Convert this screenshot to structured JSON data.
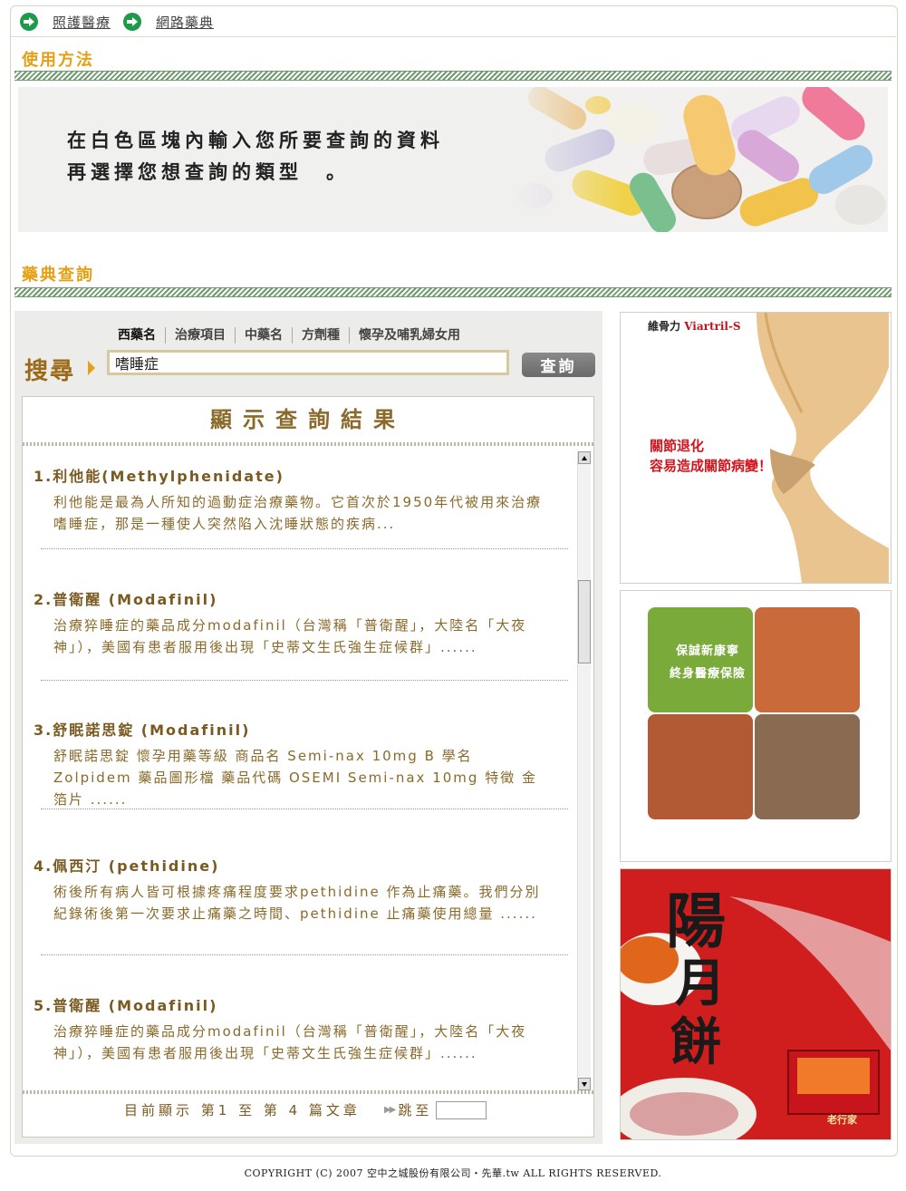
{
  "breadcrumb": {
    "items": [
      "照護醫療",
      "網路藥典"
    ]
  },
  "usage": {
    "title": "使用方法",
    "line1": "在白色區塊內輸入您所要查詢的資料",
    "line2": "再選擇您想查詢的類型　。"
  },
  "lookup": {
    "title": "藥典查詢",
    "tabs": [
      "西藥名",
      "治療項目",
      "中藥名",
      "方劑種",
      "懷孕及哺乳婦女用"
    ],
    "search_label": "搜尋",
    "search_value": "嗜睡症",
    "search_button": "查詢",
    "results_title": "顯示查詢結果",
    "results": [
      {
        "title": "1.利他能(Methylphenidate)",
        "desc": "利他能是最為人所知的過動症治療藥物。它首次於1950年代被用來治療嗜睡症，那是一種使人突然陷入沈睡狀態的疾病..."
      },
      {
        "title": "2.普衛醒 (Modafinil)",
        "desc": "治療猝睡症的藥品成分modafinil（台灣稱「普衛醒」，大陸名「大夜神」），美國有患者服用後出現「史蒂文生氏強生症候群」......"
      },
      {
        "title": "3.舒眠諾思錠 (Modafinil)",
        "desc": "舒眠諾思錠 懷孕用藥等級 商品名 Semi-nax 10mg B 學名 Zolpidem 藥品圖形檔 藥品代碼 OSEMI Semi-nax 10mg 特徵 金箔片 ......"
      },
      {
        "title": "4.佩西汀 (pethidine)",
        "desc": "術後所有病人皆可根據疼痛程度要求pethidine 作為止痛藥。我們分別紀錄術後第一次要求止痛藥之時間、pethidine 止痛藥使用總量 ......"
      },
      {
        "title": "5.普衛醒 (Modafinil)",
        "desc": "治療猝睡症的藥品成分modafinil（台灣稱「普衛醒」，大陸名「大夜神」），美國有患者服用後出現「史蒂文生氏強生症候群」......"
      }
    ],
    "pager": {
      "current": "目前顯示 第1 至 第 4 篇文章",
      "jump_label": "跳至",
      "jump_value": ""
    }
  },
  "ads": {
    "ad1_brand": "維骨力",
    "ad1_brand_en": "Viartril-S",
    "ad1_line1": "關節退化",
    "ad1_line2": "容易造成關節病變！",
    "ad2_line1": "保誠新康寧",
    "ad2_line2": "終身醫療保險",
    "ad3_title": "陽月餅",
    "ad3_brand": "老行家"
  },
  "footer": {
    "text": "COPYRIGHT (C) 2007 空中之城股份有限公司・先華.tw ALL RIGHTS RESERVED."
  },
  "colors": {
    "accent": "#e6a015",
    "stripe": "#6f9a6d",
    "result_text": "#7a5a20",
    "link_icon": "#1f9a4d"
  },
  "icons": [
    "arrow-right-circle-icon",
    "triangle-right-icon",
    "scroll-up-icon",
    "scroll-down-icon",
    "double-arrow-icon"
  ]
}
